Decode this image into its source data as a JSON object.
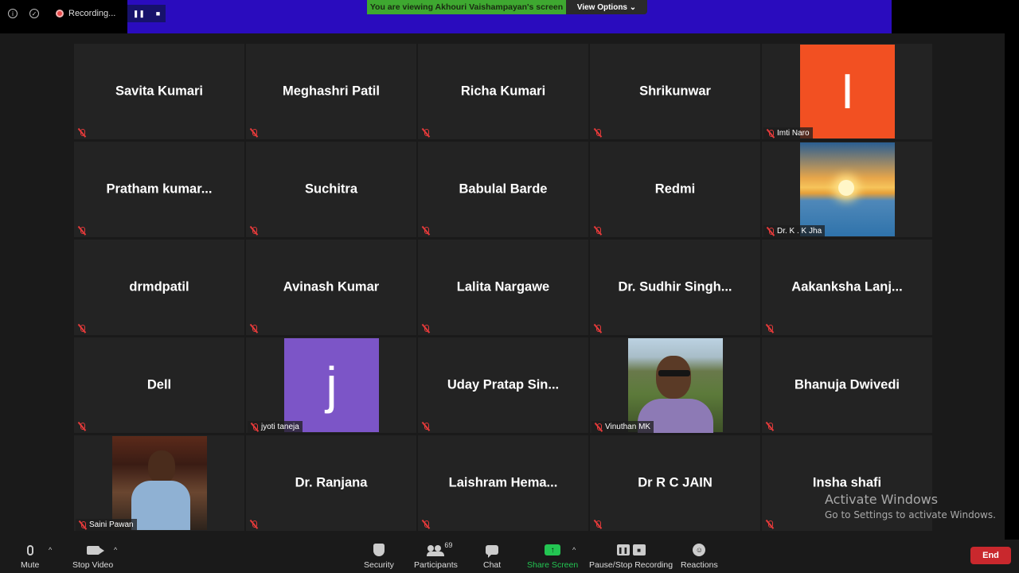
{
  "top": {
    "recording_label": "Recording...",
    "banner_text": "You are viewing Akhouri Vaishampayan's screen",
    "view_options_label": "View Options ⌄"
  },
  "tiles": [
    {
      "name": "Savita Kumari",
      "type": "name"
    },
    {
      "name": "Meghashri Patil",
      "type": "name"
    },
    {
      "name": "Richa Kumari",
      "type": "name"
    },
    {
      "name": "Shrikunwar",
      "type": "name"
    },
    {
      "name": "Imti Naro",
      "type": "initial",
      "initial": "I"
    },
    {
      "name": "Pratham  kumar...",
      "type": "name"
    },
    {
      "name": "Suchitra",
      "type": "name"
    },
    {
      "name": "Babulal Barde",
      "type": "name"
    },
    {
      "name": "Redmi",
      "type": "name"
    },
    {
      "name": "Dr. K . K Jha",
      "type": "sunset"
    },
    {
      "name": "drmdpatil",
      "type": "name"
    },
    {
      "name": "Avinash Kumar",
      "type": "name"
    },
    {
      "name": "Lalita Nargawe",
      "type": "name"
    },
    {
      "name": "Dr. Sudhir Singh...",
      "type": "name"
    },
    {
      "name": "Aakanksha  Lanj...",
      "type": "name"
    },
    {
      "name": "Dell",
      "type": "name"
    },
    {
      "name": "jyoti taneja",
      "type": "initial",
      "initial": "j"
    },
    {
      "name": "Uday  Pratap  Sin...",
      "type": "name"
    },
    {
      "name": "Vinuthan MK",
      "type": "photo1"
    },
    {
      "name": "Bhanuja Dwivedi",
      "type": "name"
    },
    {
      "name": "Saini Pawan",
      "type": "photo2"
    },
    {
      "name": "Dr. Ranjana",
      "type": "name"
    },
    {
      "name": "Laishram  Hema...",
      "type": "name"
    },
    {
      "name": "Dr R C JAIN",
      "type": "name"
    },
    {
      "name": "Insha shafi",
      "type": "name"
    }
  ],
  "toolbar": {
    "mute": "Mute",
    "stop_video": "Stop Video",
    "security": "Security",
    "participants": "Participants",
    "participants_count": "69",
    "chat": "Chat",
    "share_screen": "Share Screen",
    "pause_stop_recording": "Pause/Stop Recording",
    "reactions": "Reactions",
    "end": "End"
  },
  "watermark": {
    "line1": "Activate Windows",
    "line2": "Go to Settings to activate Windows."
  },
  "colors": {
    "banner": "#2a0cbe",
    "viewing_green": "#3ea830",
    "share_green": "#23c552",
    "end_red": "#c9282d",
    "mute_red": "#e43a3a"
  }
}
